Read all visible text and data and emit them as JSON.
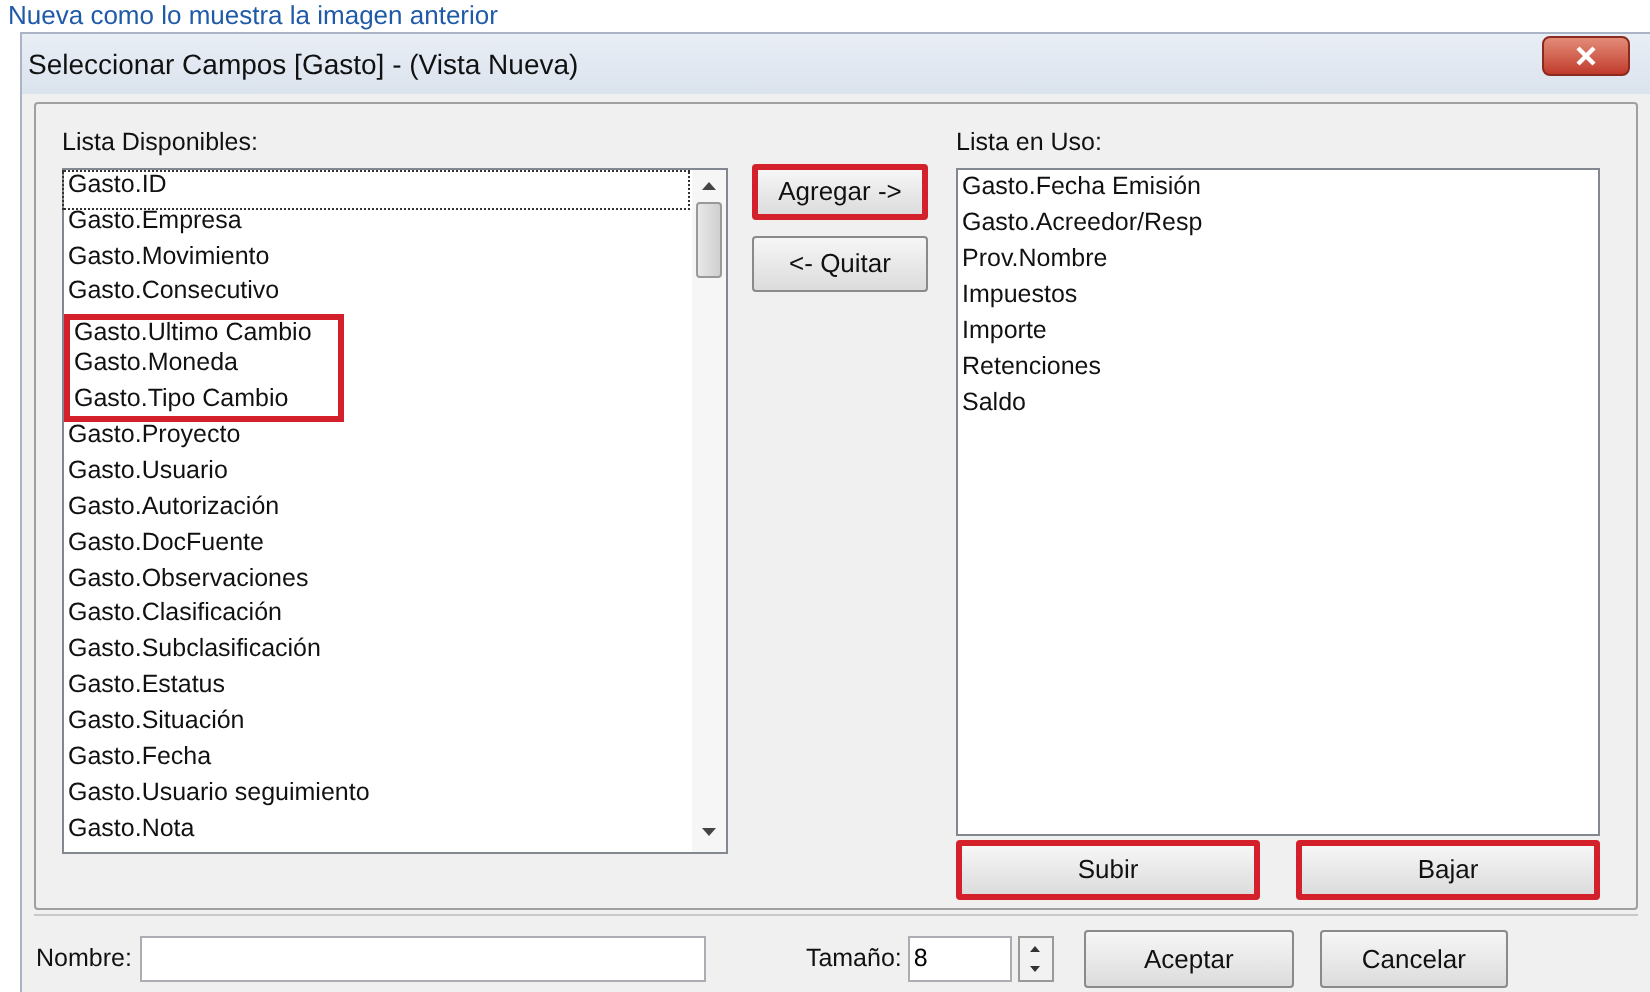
{
  "caption": "Nueva como lo muestra la imagen anterior",
  "window": {
    "title": "Seleccionar Campos [Gasto] - (Vista Nueva)"
  },
  "available": {
    "label": "Lista Disponibles:",
    "items": [
      {
        "text": "Gasto.ID",
        "focused": true,
        "highlighted": false
      },
      {
        "text": "Gasto.Empresa",
        "focused": false,
        "highlighted": false
      },
      {
        "text": "Gasto.Movimiento",
        "focused": false,
        "highlighted": false
      },
      {
        "text": "Gasto.Consecutivo",
        "focused": false,
        "highlighted": false
      },
      {
        "text": "Gasto.Ultimo Cambio",
        "focused": false,
        "highlighted": true
      },
      {
        "text": "Gasto.Moneda",
        "focused": false,
        "highlighted": true
      },
      {
        "text": "Gasto.Tipo Cambio",
        "focused": false,
        "highlighted": true
      },
      {
        "text": "Gasto.Proyecto",
        "focused": false,
        "highlighted": false
      },
      {
        "text": "Gasto.Usuario",
        "focused": false,
        "highlighted": false
      },
      {
        "text": "Gasto.Autorización",
        "focused": false,
        "highlighted": false
      },
      {
        "text": "Gasto.DocFuente",
        "focused": false,
        "highlighted": false
      },
      {
        "text": "Gasto.Observaciones",
        "focused": false,
        "highlighted": false
      },
      {
        "text": "Gasto.Clasificación",
        "focused": false,
        "highlighted": false
      },
      {
        "text": "Gasto.Subclasificación",
        "focused": false,
        "highlighted": false
      },
      {
        "text": "Gasto.Estatus",
        "focused": false,
        "highlighted": false
      },
      {
        "text": "Gasto.Situación",
        "focused": false,
        "highlighted": false
      },
      {
        "text": "Gasto.Fecha",
        "focused": false,
        "highlighted": false
      },
      {
        "text": "Gasto.Usuario seguimiento",
        "focused": false,
        "highlighted": false
      },
      {
        "text": "Gasto.Nota",
        "focused": false,
        "highlighted": false
      }
    ]
  },
  "move_buttons": [
    {
      "label": "Agregar ->",
      "highlighted": true
    },
    {
      "label": "<- Quitar",
      "highlighted": false
    }
  ],
  "in_use": {
    "label": "Lista en Uso:",
    "items": [
      "Gasto.Fecha Emisión",
      "Gasto.Acreedor/Resp",
      "Prov.Nombre",
      "Impuestos",
      "Importe",
      "Retenciones",
      "Saldo"
    ]
  },
  "order_buttons": [
    {
      "label": "Subir",
      "highlighted": true
    },
    {
      "label": "Bajar",
      "highlighted": true
    }
  ],
  "name_field": {
    "label": "Nombre:"
  },
  "size_field": {
    "label": "Tamaño:",
    "value": "8"
  },
  "dialog_buttons": [
    "Aceptar",
    "Cancelar"
  ]
}
